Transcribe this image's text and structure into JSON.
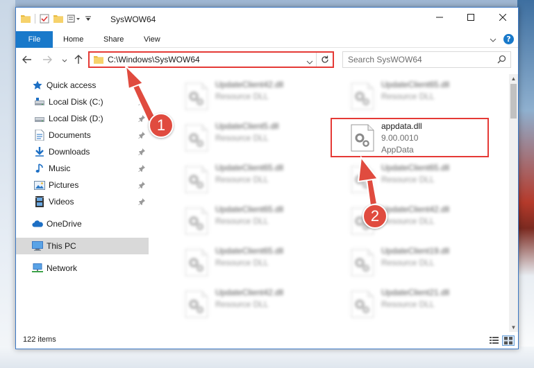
{
  "window": {
    "title": "SysWOW64",
    "minimize": "—",
    "maximize": "☐",
    "close": "✕"
  },
  "ribbon": {
    "tabs": [
      "File",
      "Home",
      "Share",
      "View"
    ],
    "help": "?"
  },
  "navigation": {
    "address_path": "C:\\Windows\\SysWOW64",
    "search_placeholder": "Search SysWOW64"
  },
  "sidebar": {
    "items": [
      {
        "label": "Quick access",
        "icon": "star-icon"
      },
      {
        "label": "Local Disk (C:)",
        "icon": "drive-icon",
        "pinned": true
      },
      {
        "label": "Local Disk (D:)",
        "icon": "drive-icon",
        "pinned": true
      },
      {
        "label": "Documents",
        "icon": "documents-icon",
        "pinned": true
      },
      {
        "label": "Downloads",
        "icon": "downloads-icon",
        "pinned": true
      },
      {
        "label": "Music",
        "icon": "music-icon",
        "pinned": true
      },
      {
        "label": "Pictures",
        "icon": "pictures-icon",
        "pinned": true
      },
      {
        "label": "Videos",
        "icon": "videos-icon",
        "pinned": true
      },
      {
        "label": "OneDrive",
        "icon": "onedrive-icon"
      },
      {
        "label": "This PC",
        "icon": "computer-icon",
        "selected": true
      },
      {
        "label": "Network",
        "icon": "network-icon"
      }
    ]
  },
  "files": {
    "left_column": [
      {
        "name": "UpdateClient42.dll",
        "type": "Resource DLL"
      },
      {
        "name": "UpdateClient5.dll",
        "type": "Resource DLL"
      },
      {
        "name": "UpdateClient65.dll",
        "type": "Resource DLL"
      },
      {
        "name": "UpdateClient65.dll",
        "type": "Resource DLL"
      },
      {
        "name": "UpdateClient65.dll",
        "type": "Resource DLL"
      },
      {
        "name": "UpdateClient42.dll",
        "type": "Resource DLL"
      }
    ],
    "right_column": [
      {
        "name": "UpdateClient65.dll",
        "type": "Resource DLL"
      },
      {
        "name": "UpdateClient65.dll",
        "type": "Resource DLL"
      },
      {
        "name": "UpdateClient42.dll",
        "type": "Resource DLL"
      },
      {
        "name": "UpdateClient19.dll",
        "type": "Resource DLL"
      },
      {
        "name": "UpdateClient21.dll",
        "type": "Resource DLL"
      }
    ],
    "selected": {
      "name": "appdata.dll",
      "version": "9.00.0010",
      "description": "AppData"
    }
  },
  "callouts": {
    "step1": "1",
    "step2": "2"
  },
  "status": {
    "item_count": "122 items"
  },
  "colors": {
    "accent": "#1979ca",
    "highlight": "#e53935",
    "arrow": "#e04b3f"
  }
}
